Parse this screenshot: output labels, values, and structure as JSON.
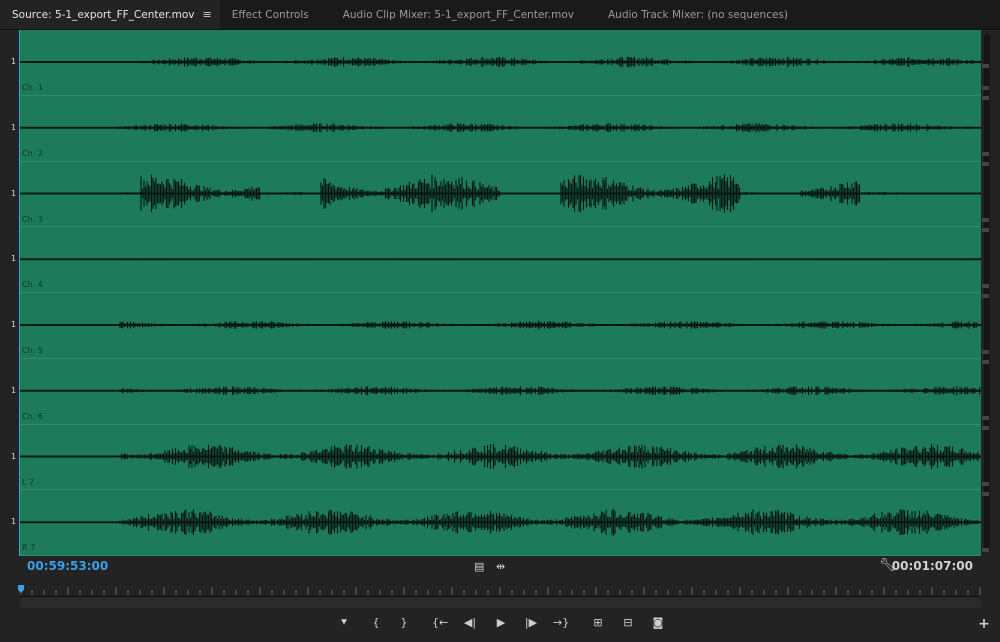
{
  "tabs": [
    {
      "label": "Source: 5-1_export_FF_Center.mov",
      "active": true
    },
    {
      "label": "Effect Controls",
      "active": false
    },
    {
      "label": "Audio Clip Mixer: 5-1_export_FF_Center.mov",
      "active": false
    },
    {
      "label": "Audio Track Mixer: (no sequences)",
      "active": false
    }
  ],
  "tab_menu_icon": "hamburger-menu-icon",
  "channels": [
    {
      "scale": "1",
      "label": "Ch. 1",
      "amplitude": 0.15
    },
    {
      "scale": "1",
      "label": "Ch. 2",
      "amplitude": 0.13
    },
    {
      "scale": "1",
      "label": "Ch. 3",
      "amplitude": 0.55
    },
    {
      "scale": "1",
      "label": "Ch. 4",
      "amplitude": 0.02
    },
    {
      "scale": "1",
      "label": "Ch. 5",
      "amplitude": 0.12
    },
    {
      "scale": "1",
      "label": "Ch. 6",
      "amplitude": 0.13
    },
    {
      "scale": "1",
      "label": "L 7",
      "amplitude": 0.35
    },
    {
      "scale": "1",
      "label": "R 7",
      "amplitude": 0.38
    }
  ],
  "timecode_in": "00:59:53:00",
  "timecode_duration": "00:01:07:00",
  "colors": {
    "waveform_bg": "#1d7a5a",
    "timecode_accent": "#3aa0e8"
  },
  "controls": {
    "center_icons": [
      "drag-video-only-icon",
      "drag-audio-only-icon"
    ],
    "settings_icon": "wrench-icon",
    "buttons": [
      {
        "name": "add-marker-button",
        "icon": "marker-icon",
        "glyph": "⯆"
      },
      {
        "name": "mark-in-button",
        "icon": "mark-in-icon",
        "glyph": "{"
      },
      {
        "name": "mark-out-button",
        "icon": "mark-out-icon",
        "glyph": "}"
      },
      {
        "name": "go-to-in-button",
        "icon": "go-to-in-icon",
        "glyph": "{←"
      },
      {
        "name": "step-back-button",
        "icon": "step-back-icon",
        "glyph": "◀|"
      },
      {
        "name": "play-button",
        "icon": "play-icon",
        "glyph": "▶"
      },
      {
        "name": "step-forward-button",
        "icon": "step-forward-icon",
        "glyph": "|▶"
      },
      {
        "name": "go-to-out-button",
        "icon": "go-to-out-icon",
        "glyph": "→}"
      },
      {
        "name": "insert-button",
        "icon": "insert-icon",
        "glyph": "⊞"
      },
      {
        "name": "overwrite-button",
        "icon": "overwrite-icon",
        "glyph": "⊟"
      },
      {
        "name": "export-frame-button",
        "icon": "camera-icon",
        "glyph": "◙"
      }
    ],
    "add_button_glyph": "+"
  }
}
